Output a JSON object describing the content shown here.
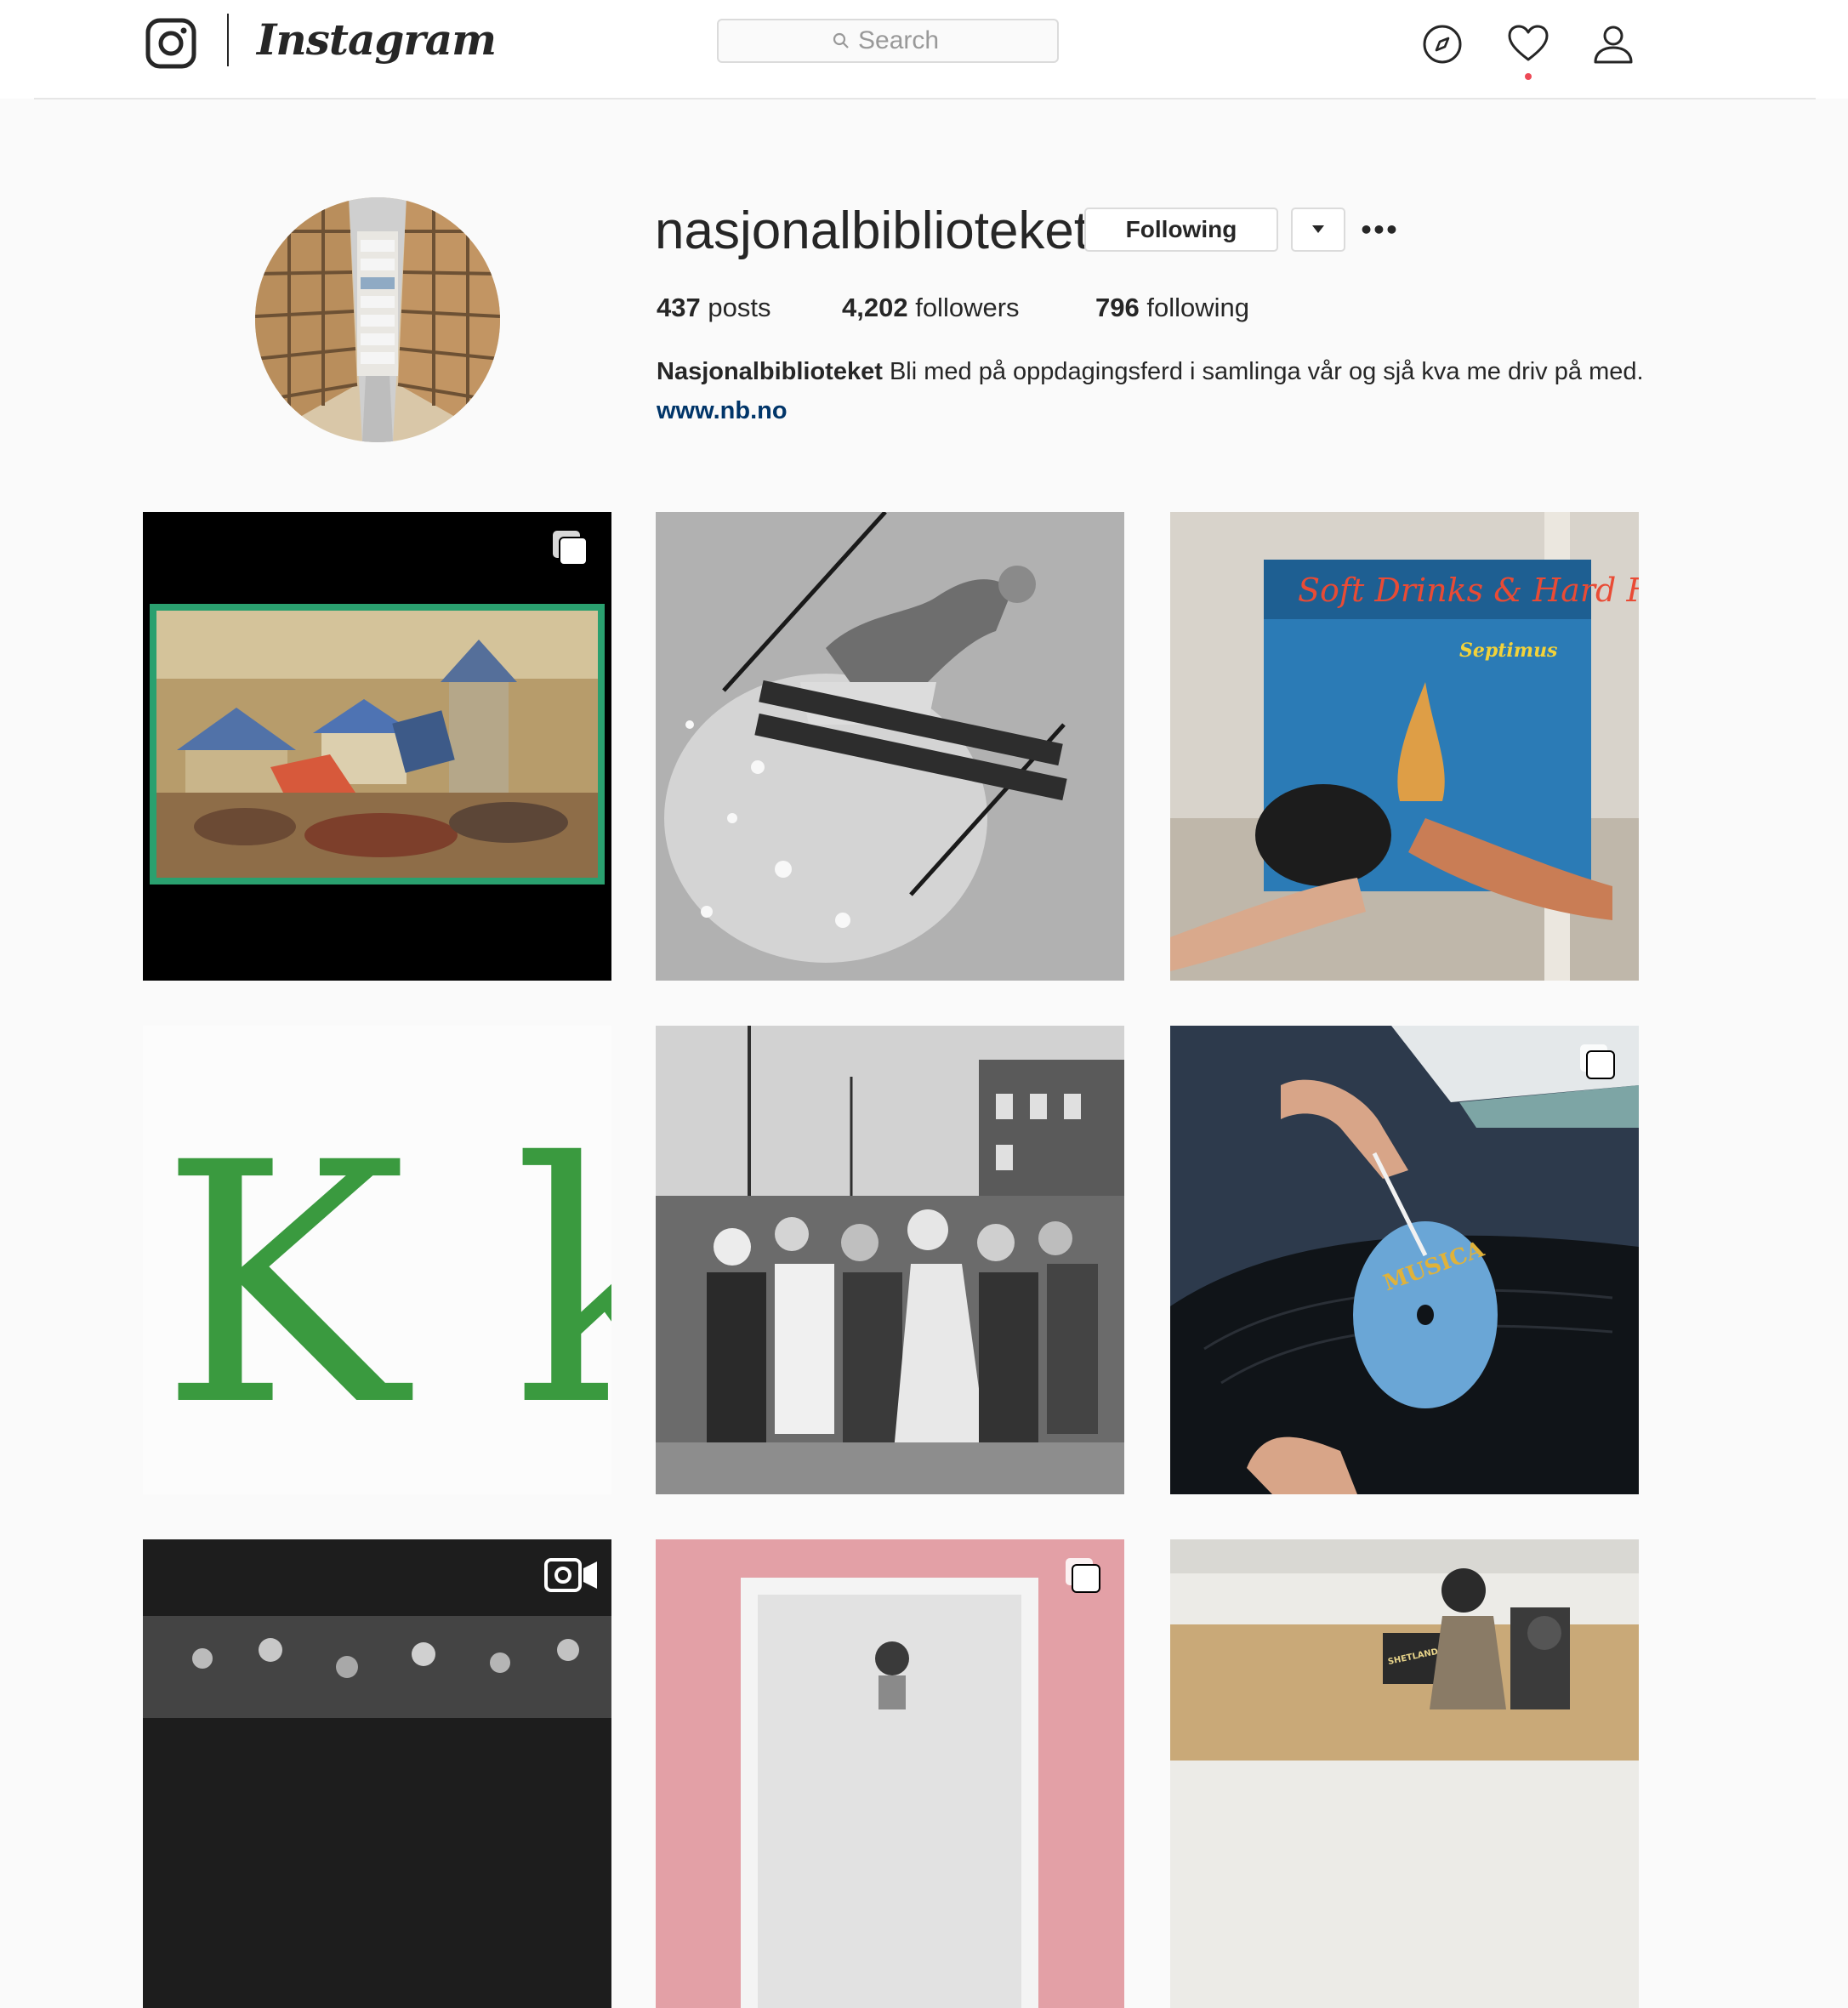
{
  "nav": {
    "wordmark": "Instagram",
    "search_placeholder": "Search",
    "icons": [
      "compass-icon",
      "heart-icon",
      "user-icon"
    ],
    "has_notification": true
  },
  "profile": {
    "username": "nasjonalbiblioteket",
    "following_button": "Following",
    "stats": {
      "posts_count": "437",
      "posts_label": "posts",
      "followers_count": "4,202",
      "followers_label": "followers",
      "following_count": "796",
      "following_label": "following"
    },
    "bio": {
      "name": "Nasjonalbiblioteket",
      "text_line1": "Bli med på oppdagingsferd i samlinga vår og sjå kva me driv",
      "text_line2": "på med.",
      "link": "www.nb.no"
    }
  },
  "posts": [
    {
      "badge": "multi-photo-icon"
    },
    {
      "badge": ""
    },
    {
      "badge": "",
      "album_text": "Soft Drinks & Hard Fights",
      "album_artist": "Septimus"
    },
    {
      "badge": "",
      "letters": "K k"
    },
    {
      "badge": ""
    },
    {
      "badge": "multi-photo-icon",
      "label_text": "MUSICA"
    },
    {
      "badge": "video-icon"
    },
    {
      "badge": "multi-photo-icon"
    },
    {
      "badge": "",
      "sign_text": "SHETLANDS GJENGEN"
    }
  ],
  "colors": {
    "accent_link": "#003569",
    "notification_dot": "#ed4956",
    "k_letter": "#3a9a3f",
    "pink_tile": "#e3a0a6"
  }
}
